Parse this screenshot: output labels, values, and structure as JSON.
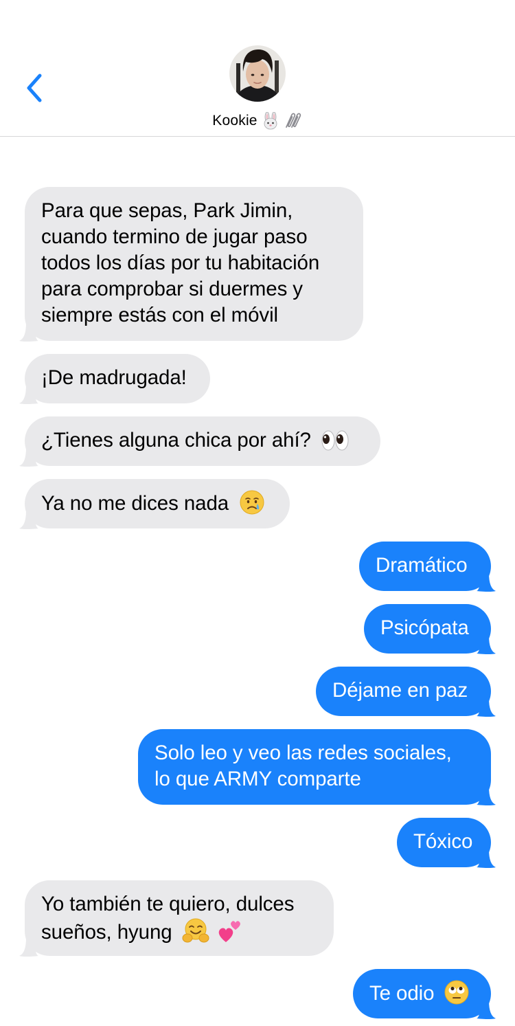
{
  "header": {
    "contact_name": "Kookie",
    "name_emojis": [
      "rabbit-face-icon",
      "paperclips-icon"
    ],
    "icons": {
      "back": "chevron-left-icon",
      "avatar": "contact-photo"
    }
  },
  "colors": {
    "accent": "#1a82fb",
    "incoming_bubble": "#e9e9eb",
    "outgoing_text": "#ffffff",
    "divider": "#d6d6d8"
  },
  "messages": [
    {
      "direction": "incoming",
      "lines": [
        "Para que sepas, Park Jimin,",
        "cuando termino de jugar paso",
        "todos los días por tu habitación",
        "para comprobar si duermes y",
        "siempre estás con el móvil"
      ]
    },
    {
      "direction": "incoming",
      "lines": [
        "¡De madrugada!"
      ]
    },
    {
      "direction": "incoming",
      "lines": [
        "¿Tienes alguna chica por ahí?"
      ],
      "emoji": "eyes-emoji"
    },
    {
      "direction": "incoming",
      "lines": [
        "Ya no me dices nada"
      ],
      "emoji": "crying-face-emoji"
    },
    {
      "direction": "outgoing",
      "lines": [
        "Dramático"
      ]
    },
    {
      "direction": "outgoing",
      "lines": [
        "Psicópata"
      ]
    },
    {
      "direction": "outgoing",
      "lines": [
        "Déjame en paz"
      ]
    },
    {
      "direction": "outgoing",
      "lines": [
        "Solo leo y veo las redes sociales,",
        "lo que ARMY comparte"
      ]
    },
    {
      "direction": "outgoing",
      "lines": [
        "Tóxico"
      ]
    },
    {
      "direction": "incoming",
      "lines": [
        "Yo también te quiero, dulces",
        "sueños, hyung"
      ],
      "emoji": [
        "hugging-face-emoji",
        "two-hearts-emoji"
      ]
    },
    {
      "direction": "outgoing",
      "lines": [
        "Te odio"
      ],
      "emoji": "rolling-eyes-emoji"
    }
  ]
}
